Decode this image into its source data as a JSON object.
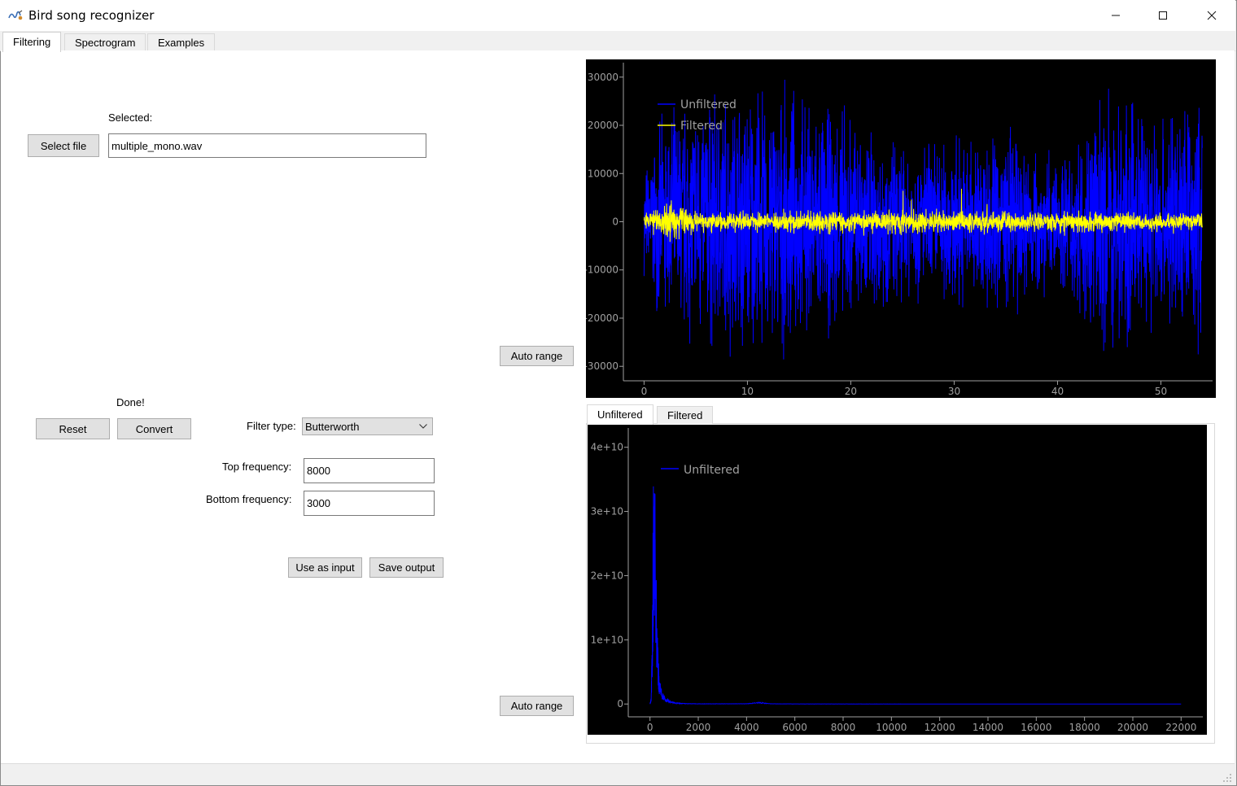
{
  "window": {
    "title": "Bird song recognizer",
    "controls": [
      "minimize",
      "maximize",
      "close"
    ]
  },
  "tabs": [
    {
      "label": "Filtering",
      "active": true
    },
    {
      "label": "Spectrogram",
      "active": false
    },
    {
      "label": "Examples",
      "active": false
    }
  ],
  "file": {
    "selected_label": "Selected:",
    "select_button": "Select file",
    "filename": "multiple_mono.wav"
  },
  "filter": {
    "status": "Done!",
    "reset_button": "Reset",
    "convert_button": "Convert",
    "type_label": "Filter type:",
    "type_value": "Butterworth",
    "top_label": "Top frequency:",
    "top_value": "8000",
    "bottom_label": "Bottom frequency:",
    "bottom_value": "3000",
    "use_input_button": "Use as input",
    "save_output_button": "Save output"
  },
  "auto_range_top": "Auto range",
  "auto_range_bottom": "Auto range",
  "sub_tabs": [
    {
      "label": "Unfiltered",
      "active": true
    },
    {
      "label": "Filtered",
      "active": false
    }
  ],
  "colors": {
    "unfiltered": "#0000ff",
    "filtered": "#ffff00",
    "plot_bg": "#000000",
    "axis_text": "#a0a0a0"
  },
  "chart_data": [
    {
      "type": "line",
      "xlim": [
        -2,
        55
      ],
      "ylim": [
        -33000,
        33000
      ],
      "x_ticks": [
        0,
        10,
        20,
        30,
        40,
        50
      ],
      "y_ticks": [
        30000,
        20000,
        10000,
        0,
        -10000,
        -20000,
        -30000
      ],
      "grid": false,
      "legend_position": "top-left",
      "series": [
        {
          "name": "Unfiltered",
          "color": "#0000ff",
          "x_range": [
            0,
            54
          ],
          "amplitude_envelope": [
            [
              0,
              12000
            ],
            [
              2,
              25000
            ],
            [
              5,
              30000
            ],
            [
              10,
              32000
            ],
            [
              16,
              28000
            ],
            [
              20,
              26000
            ],
            [
              25,
              18000
            ],
            [
              30,
              20000
            ],
            [
              35,
              22000
            ],
            [
              40,
              15000
            ],
            [
              45,
              30000
            ],
            [
              50,
              26000
            ],
            [
              54,
              30000
            ]
          ]
        },
        {
          "name": "Filtered",
          "color": "#ffff00",
          "x_range": [
            0,
            54
          ],
          "amplitude_envelope": [
            [
              0,
              2000
            ],
            [
              3,
              6000
            ],
            [
              5,
              2500
            ],
            [
              20,
              3000
            ],
            [
              35,
              3000
            ],
            [
              54,
              2500
            ]
          ]
        }
      ]
    },
    {
      "type": "line",
      "xlim": [
        -900,
        22900
      ],
      "ylim": [
        -2000000000,
        43000000000
      ],
      "x_ticks": [
        0,
        2000,
        4000,
        6000,
        8000,
        10000,
        12000,
        14000,
        16000,
        18000,
        20000,
        22000
      ],
      "x_tick_labels": [
        "0",
        "2000",
        "4000",
        "6000",
        "8000",
        "10000",
        "12000",
        "14000",
        "16000",
        "18000",
        "20000",
        "22000"
      ],
      "y_ticks": [
        0,
        10000000000,
        20000000000,
        30000000000,
        40000000000
      ],
      "y_tick_labels": [
        "0",
        "1e+10",
        "2e+10",
        "3e+10",
        "4e+10"
      ],
      "grid": false,
      "legend_position": "top-left",
      "series": [
        {
          "name": "Unfiltered",
          "color": "#0000ff",
          "x": [
            0,
            50,
            100,
            150,
            200,
            250,
            300,
            350,
            400,
            500,
            600,
            800,
            1000,
            1200,
            1500,
            2000,
            4000,
            4500,
            5000,
            6000,
            10000,
            16000,
            22000
          ],
          "y": [
            0,
            1000000000,
            15000000000,
            41000000000,
            35000000000,
            22000000000,
            12000000000,
            7000000000,
            4000000000,
            2000000000,
            1200000000,
            600000000,
            300000000,
            150000000,
            80000000,
            40000000,
            50000000,
            300000000,
            50000000,
            20000000,
            10000000,
            5000000,
            3000000
          ]
        }
      ]
    }
  ]
}
